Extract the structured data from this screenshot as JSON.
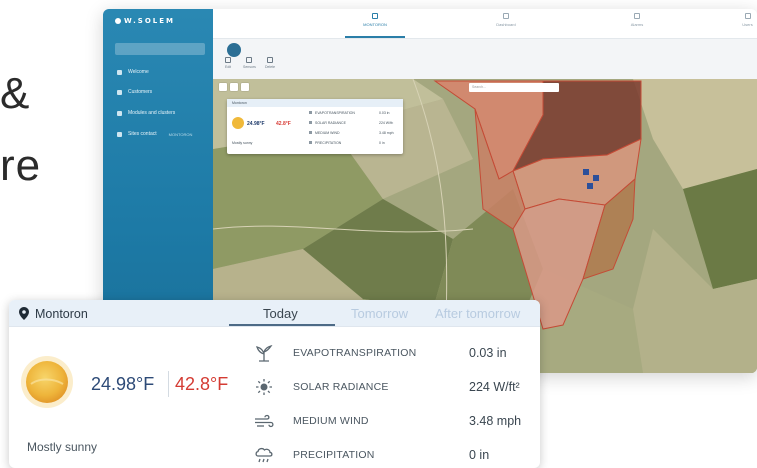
{
  "background_text": {
    "line1": "&",
    "line2": "re"
  },
  "app": {
    "logo": "W.SOLEM",
    "sidebar": {
      "items": [
        {
          "label": "Welcome",
          "extra": ""
        },
        {
          "label": "Customers",
          "extra": ""
        },
        {
          "label": "Modules and clusters",
          "extra": ""
        },
        {
          "label": "Sites contact",
          "extra": "MONTORON"
        }
      ]
    },
    "topnav": {
      "tabs": [
        {
          "label": "MONTORON"
        },
        {
          "label": "Dashboard"
        },
        {
          "label": "Alarms"
        },
        {
          "label": "Users"
        }
      ]
    },
    "toolbar": {
      "buttons": [
        {
          "label": "Edit"
        },
        {
          "label": "Sensors"
        },
        {
          "label": "Delete"
        }
      ]
    },
    "map_search_placeholder": "Search..."
  },
  "weather": {
    "location": "Montoron",
    "tabs": {
      "today": "Today",
      "tomorrow": "Tomorrow",
      "after": "After tomorrow"
    },
    "temp_low": "24.98°F",
    "temp_high": "42.8°F",
    "condition": "Mostly sunny",
    "metrics": [
      {
        "name": "EVAPOTRANSPIRATION",
        "value": "0.03 in",
        "icon": "plant-icon"
      },
      {
        "name": "SOLAR RADIANCE",
        "value": "224 W/ft²",
        "icon": "sun-rays-icon"
      },
      {
        "name": "MEDIUM WIND",
        "value": "3.48 mph",
        "icon": "wind-icon"
      },
      {
        "name": "PRECIPITATION",
        "value": "0 in",
        "icon": "rain-icon"
      }
    ]
  },
  "colors": {
    "sidebar": "#2383ad",
    "accent": "#2a7ea8",
    "temp_low": "#2d4a77",
    "temp_high": "#d43b33",
    "field_red": "#d9846c"
  }
}
